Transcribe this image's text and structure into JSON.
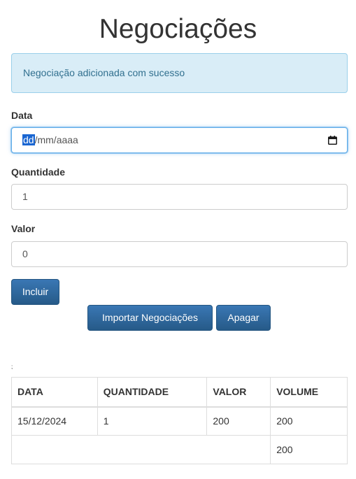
{
  "page": {
    "title": "Negociações"
  },
  "alert": {
    "message": "Negociação adicionada com sucesso"
  },
  "form": {
    "date": {
      "label": "Data",
      "segments": [
        "dd",
        "mm",
        "aaaa"
      ],
      "separator": "/"
    },
    "quantity": {
      "label": "Quantidade",
      "value": "1"
    },
    "value": {
      "label": "Valor",
      "value": "0"
    },
    "submit_label": "Incluir"
  },
  "actions": {
    "import_label": "Importar Negociações",
    "clear_label": "Apagar"
  },
  "table_marker": ";",
  "table": {
    "headers": [
      "DATA",
      "QUANTIDADE",
      "VALOR",
      "VOLUME"
    ],
    "rows": [
      [
        "15/12/2024",
        "1",
        "200",
        "200"
      ]
    ],
    "footer_total": "200"
  },
  "colors": {
    "primary": "#337ab7",
    "alert_bg": "#d9edf7",
    "alert_text": "#31708f",
    "focus": "#66afe9"
  },
  "icons": {
    "date_picker": "calendar-icon"
  }
}
